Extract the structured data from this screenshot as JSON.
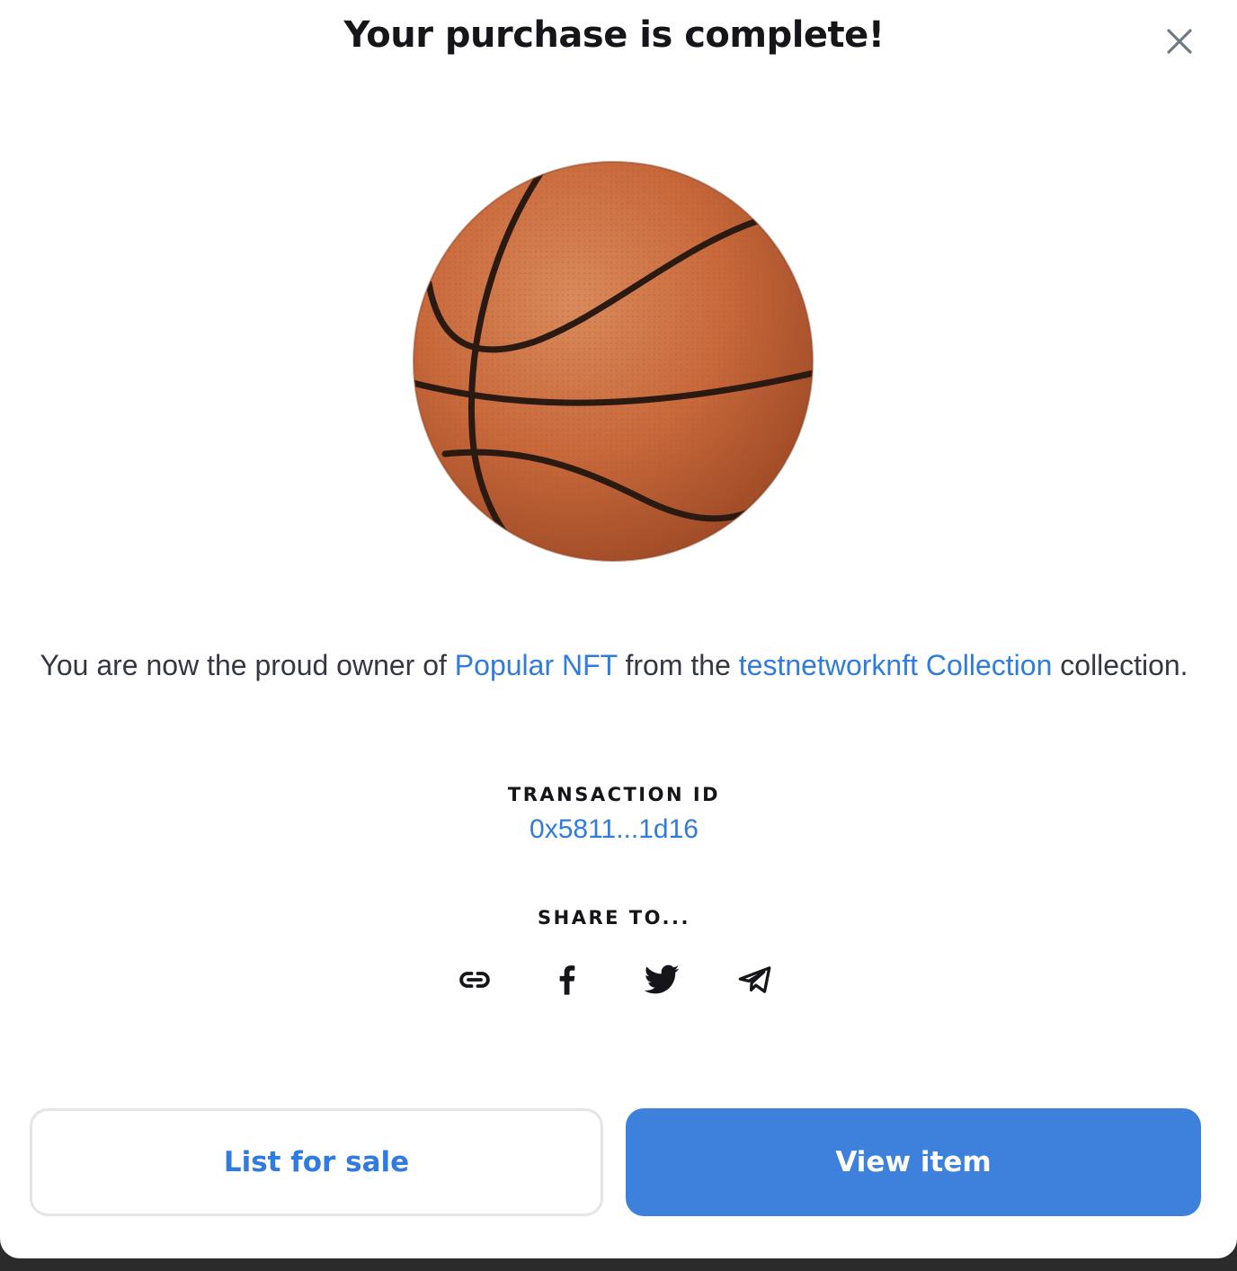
{
  "modal": {
    "title": "Your purchase is complete!",
    "close_icon": "close-icon"
  },
  "item_image": {
    "icon": "basketball-image"
  },
  "ownership": {
    "prefix": "You are now the proud owner of ",
    "item_name": "Popular NFT",
    "middle": " from the ",
    "collection_name": "testnetworknft Collection",
    "suffix": " collection."
  },
  "transaction": {
    "label": "TRANSACTION ID",
    "id": "0x5811...1d16"
  },
  "share": {
    "label": "SHARE TO...",
    "icons": [
      "link-icon",
      "facebook-icon",
      "twitter-icon",
      "telegram-icon"
    ]
  },
  "actions": {
    "list_for_sale": "List for sale",
    "view_item": "View item"
  },
  "colors": {
    "accent": "#2f7be0",
    "primary_button": "#3d81dc",
    "text_dark": "#15151a",
    "ball": "#c8683b"
  }
}
